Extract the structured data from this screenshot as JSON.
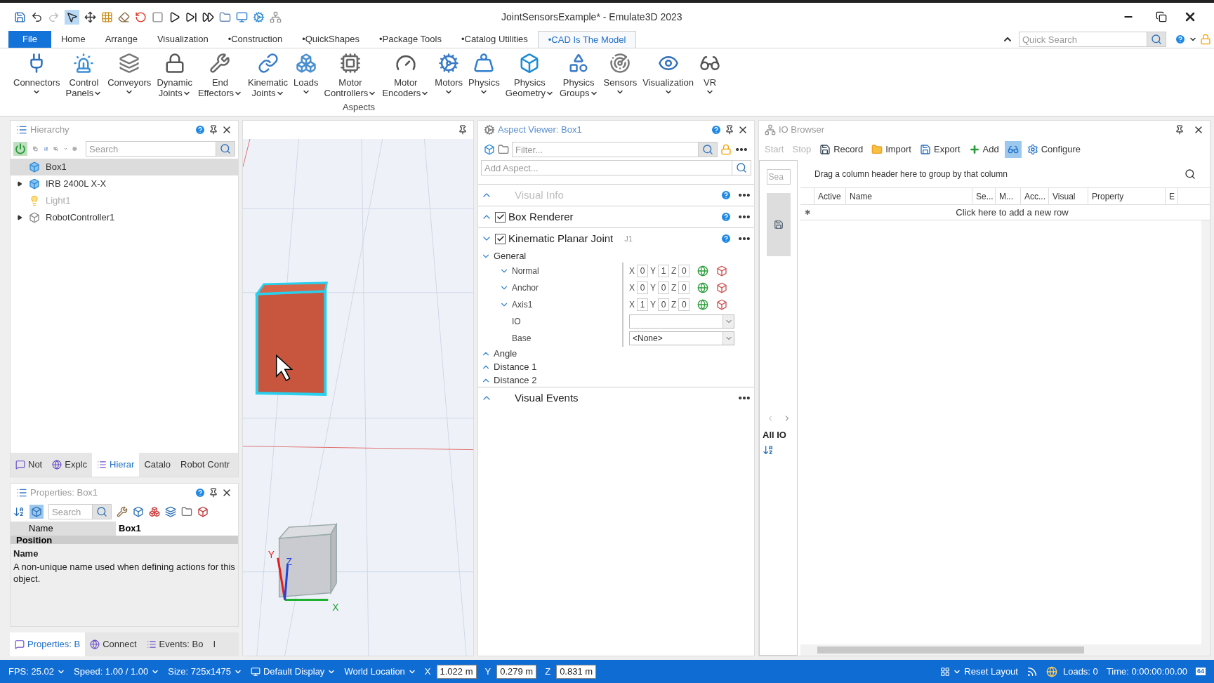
{
  "window": {
    "title": "JointSensorsExample* - Emulate3D 2023"
  },
  "ribbon_tabs": [
    {
      "label": "File",
      "kind": "file",
      "selected": false
    },
    {
      "label": "Home",
      "kind": "tab",
      "selected": false
    },
    {
      "label": "Arrange",
      "kind": "tab",
      "selected": false
    },
    {
      "label": "Visualization",
      "kind": "tab",
      "selected": false
    },
    {
      "label": "•Construction",
      "kind": "tab",
      "selected": false
    },
    {
      "label": "•QuickShapes",
      "kind": "tab",
      "selected": false
    },
    {
      "label": "•Package Tools",
      "kind": "tab",
      "selected": false
    },
    {
      "label": "•Catalog Utilities",
      "kind": "tab",
      "selected": false
    },
    {
      "label": "•CAD Is The Model",
      "kind": "tab",
      "selected": true
    }
  ],
  "quick_search": {
    "placeholder": "Quick Search"
  },
  "ribbon_items": [
    {
      "lines": [
        "Connectors"
      ],
      "dropdown": true
    },
    {
      "lines": [
        "Control",
        "Panels"
      ],
      "dropdown": true
    },
    {
      "lines": [
        "Conveyors"
      ],
      "dropdown": true
    },
    {
      "lines": [
        "Dynamic",
        "Joints"
      ],
      "dropdown": true
    },
    {
      "lines": [
        "End",
        "Effectors"
      ],
      "dropdown": true
    },
    {
      "lines": [
        "Kinematic",
        "Joints"
      ],
      "dropdown": true
    },
    {
      "lines": [
        "Loads"
      ],
      "dropdown": true
    },
    {
      "lines": [
        "Motor",
        "Controllers"
      ],
      "dropdown": true
    },
    {
      "lines": [
        "Motor",
        "Encoders"
      ],
      "dropdown": true
    },
    {
      "lines": [
        "Motors"
      ],
      "dropdown": true
    },
    {
      "lines": [
        "Physics"
      ],
      "dropdown": true
    },
    {
      "lines": [
        "Physics",
        "Geometry"
      ],
      "dropdown": true
    },
    {
      "lines": [
        "Physics",
        "Groups"
      ],
      "dropdown": true
    },
    {
      "lines": [
        "Sensors"
      ],
      "dropdown": true
    },
    {
      "lines": [
        "Visualization"
      ],
      "dropdown": true
    },
    {
      "lines": [
        "VR"
      ],
      "dropdown": true
    }
  ],
  "ribbon_group": "Aspects",
  "hierarchy": {
    "title": "Hierarchy",
    "search_placeholder": "Search",
    "items": [
      {
        "label": "Box1",
        "selected": true,
        "collapsed": false,
        "disabled": false
      },
      {
        "label": "IRB 2400L X-X",
        "selected": false,
        "collapsed": true,
        "disabled": false
      },
      {
        "label": "Light1",
        "selected": false,
        "collapsed": false,
        "disabled": true
      },
      {
        "label": "RobotController1",
        "selected": false,
        "collapsed": true,
        "disabled": false
      }
    ]
  },
  "left_tabs": [
    {
      "label": "Not",
      "selected": false
    },
    {
      "label": "Explc",
      "selected": false
    },
    {
      "label": "Hierar",
      "selected": true
    },
    {
      "label": "Catalo",
      "selected": false
    },
    {
      "label": "Robot Contr",
      "selected": false
    }
  ],
  "properties": {
    "title": "Properties: Box1",
    "search_placeholder": "Search",
    "rows": [
      {
        "name": "Name",
        "value": "Box1"
      }
    ],
    "section": "Position",
    "help_title": "Name",
    "help_text": "A non-unique name used when defining actions for this object."
  },
  "bottom_tabs": [
    {
      "label": "Properties: B",
      "selected": true
    },
    {
      "label": "Connect",
      "selected": false
    },
    {
      "label": "Events: Bo",
      "selected": false
    },
    {
      "label": "I",
      "selected": false
    }
  ],
  "viewport": {
    "axis_labels": [
      "Y",
      "Z",
      "X"
    ]
  },
  "aspect_viewer": {
    "title": "Aspect Viewer: Box1",
    "filter_placeholder": "Filter...",
    "add_placeholder": "Add Aspect...",
    "aspects": [
      {
        "label": "Visual Info",
        "kind": "plain",
        "disabled": true,
        "expanded": false,
        "help": true
      },
      {
        "label": "Box Renderer",
        "kind": "checkable",
        "checked": true,
        "disabled": false,
        "expanded": false,
        "help": true
      },
      {
        "label": "Kinematic Planar Joint",
        "kind": "checkable",
        "checked": true,
        "disabled": false,
        "expanded": true,
        "help": true,
        "tag": "J1",
        "sections": [
          {
            "label": "General",
            "expanded": true,
            "properties": [
              {
                "kind": "vector",
                "label": "Normal",
                "expanded": true,
                "components": [
                  {
                    "axis": "X",
                    "value": "0"
                  },
                  {
                    "axis": "Y",
                    "value": "1"
                  },
                  {
                    "axis": "Z",
                    "value": "0"
                  }
                ]
              },
              {
                "kind": "vector",
                "label": "Anchor",
                "expanded": true,
                "components": [
                  {
                    "axis": "X",
                    "value": "0"
                  },
                  {
                    "axis": "Y",
                    "value": "0"
                  },
                  {
                    "axis": "Z",
                    "value": "0"
                  }
                ]
              },
              {
                "kind": "vector",
                "label": "Axis1",
                "expanded": true,
                "components": [
                  {
                    "axis": "X",
                    "value": "1"
                  },
                  {
                    "axis": "Y",
                    "value": "0"
                  },
                  {
                    "axis": "Z",
                    "value": "0"
                  }
                ]
              },
              {
                "kind": "dropdown",
                "label": "IO"
              },
              {
                "kind": "dropdown",
                "label": "Base",
                "value": "<None>"
              }
            ]
          },
          {
            "label": "Angle",
            "expanded": false
          },
          {
            "label": "Distance 1",
            "expanded": false
          },
          {
            "label": "Distance 2",
            "expanded": false
          }
        ]
      },
      {
        "label": "Visual Events",
        "kind": "plain",
        "disabled": false,
        "expanded": false,
        "help": false
      }
    ]
  },
  "io_browser": {
    "title": "IO Browser",
    "toolbar": [
      {
        "kind": "text",
        "label": "Start",
        "disabled": true
      },
      {
        "kind": "text",
        "label": "Stop",
        "disabled": true
      },
      {
        "kind": "record",
        "label": "Record",
        "disabled": false
      },
      {
        "kind": "import",
        "label": "Import",
        "disabled": false
      },
      {
        "kind": "export",
        "label": "Export",
        "disabled": false
      },
      {
        "kind": "add",
        "label": "Add",
        "disabled": false
      },
      {
        "kind": "toggle",
        "selected": true
      },
      {
        "kind": "configure",
        "label": "Configure",
        "disabled": false
      }
    ],
    "side_search_placeholder": "Sea",
    "side_label": "All IO",
    "group_hint": "Drag a column header here to group by that column",
    "columns": [
      "Active",
      "Name",
      "Se...",
      "M...",
      "Acc...",
      "Visual",
      "Property",
      "E"
    ],
    "new_row_marker": "✱",
    "new_row": "Click here to add a new row"
  },
  "status_bar": [
    {
      "kind": "dropdown",
      "label": "FPS: 25.02"
    },
    {
      "kind": "dropdown",
      "label": "Speed: 1.00 / 1.00"
    },
    {
      "kind": "dropdown",
      "label": "Size: 725x1475"
    },
    {
      "kind": "display",
      "label": "Default Display"
    },
    {
      "kind": "dropdown",
      "label": "World Location"
    },
    {
      "kind": "coord",
      "label": "X",
      "value": "1.022 m"
    },
    {
      "kind": "coord",
      "label": "Y",
      "value": "0.279 m"
    },
    {
      "kind": "coord",
      "label": "Z",
      "value": "0.831 m"
    },
    {
      "kind": "spacer"
    },
    {
      "kind": "layout",
      "label": "Reset Layout"
    },
    {
      "kind": "rss"
    },
    {
      "kind": "loads",
      "label": "Loads: 0"
    },
    {
      "kind": "text",
      "label": "Time: 0:00:00:00.00"
    },
    {
      "kind": "badge",
      "label": "64"
    }
  ]
}
